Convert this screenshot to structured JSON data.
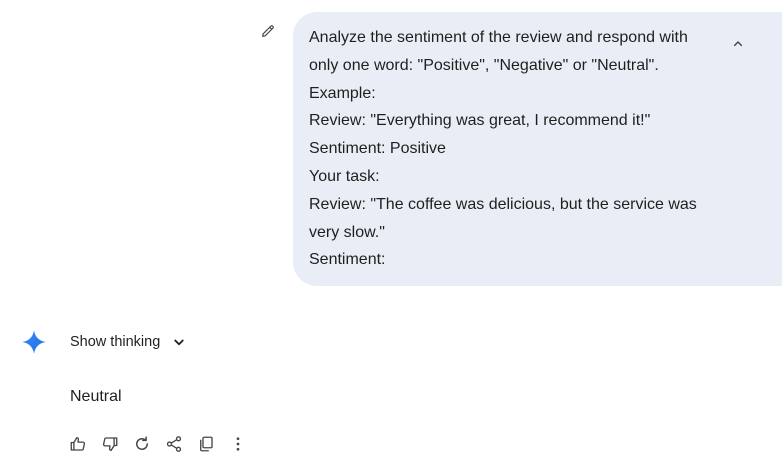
{
  "user_prompt": {
    "lines": [
      "Analyze the sentiment of the review and respond with",
      "only one word: \"Positive\", \"Negative\" or \"Neutral\".",
      "Example:",
      "Review: \"Everything was great, I recommend it!\"",
      "Sentiment: Positive",
      "Your task:",
      "Review: \"The coffee was delicious, but the service was",
      "very slow.\"",
      "Sentiment:"
    ],
    "bubble_color": "#e9eef6",
    "edit_icon": "pencil-icon",
    "collapse_icon": "chevron-up-icon"
  },
  "response": {
    "logo_icon": "gemini-sparkle-icon",
    "show_thinking_label": "Show thinking",
    "show_thinking_icon": "chevron-down-icon",
    "text": "Neutral",
    "action_icons": [
      "thumbs-up-icon",
      "thumbs-down-icon",
      "regenerate-icon",
      "share-icon",
      "copy-icon",
      "more-vert-icon"
    ]
  }
}
